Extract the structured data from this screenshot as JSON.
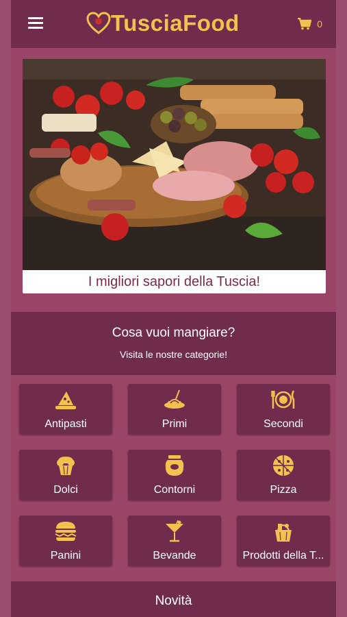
{
  "header": {
    "app_name": "TusciaFood",
    "cart_count": "0",
    "accent_color": "#f2c14e",
    "bar_color": "#6f2c4d"
  },
  "hero": {
    "caption": "I migliori sapori della Tuscia!"
  },
  "categories_section": {
    "title": "Cosa vuoi mangiare?",
    "subtitle": "Visita le nostre categorie!"
  },
  "categories": [
    {
      "label": "Antipasti",
      "icon": "cheese-board-icon"
    },
    {
      "label": "Primi",
      "icon": "pasta-plate-icon"
    },
    {
      "label": "Secondi",
      "icon": "plate-cutlery-icon"
    },
    {
      "label": "Dolci",
      "icon": "muffin-icon"
    },
    {
      "label": "Contorni",
      "icon": "jar-icon"
    },
    {
      "label": "Pizza",
      "icon": "pizza-icon"
    },
    {
      "label": "Panini",
      "icon": "burger-icon"
    },
    {
      "label": "Bevande",
      "icon": "cocktail-icon"
    },
    {
      "label": "Prodotti della T...",
      "icon": "gift-basket-icon"
    }
  ],
  "footer": {
    "news_label": "Novità"
  }
}
